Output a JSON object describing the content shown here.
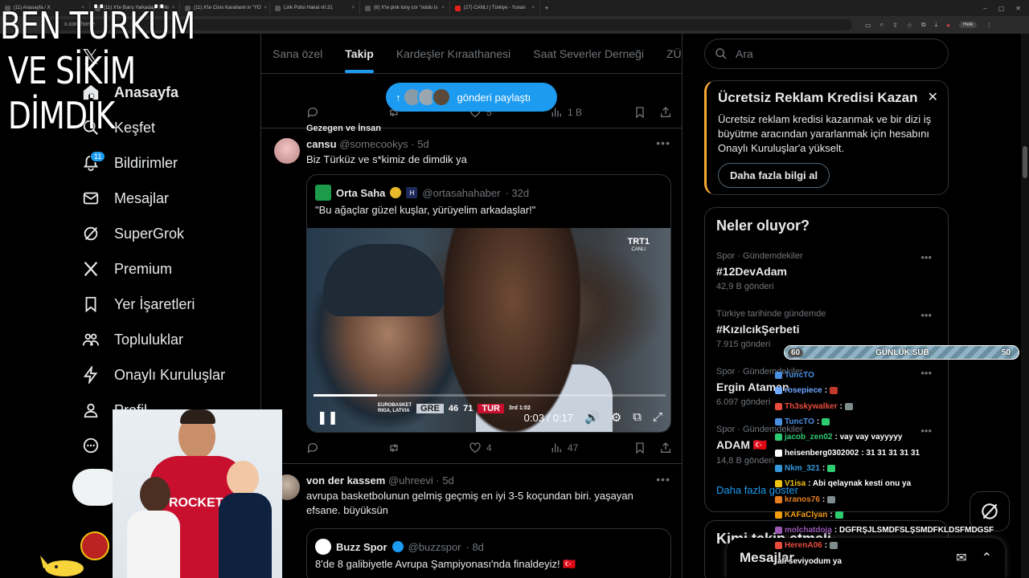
{
  "browser": {
    "tabs": [
      {
        "label": "(11) Anasayfa / X",
        "fav": "x"
      },
      {
        "label": "(11) X'te Barış Yarkadaş: Türki",
        "fav": "x"
      },
      {
        "label": "(11) X'te Cüvs Karahanlı in \"YO",
        "fav": "x"
      },
      {
        "label": "Link Polisi Hakat v0.31",
        "fav": "link"
      },
      {
        "label": "(6) X'te pink tony cor \"noldu ls",
        "fav": "x"
      },
      {
        "label": "(27) CANLI | Türkiye - Yunan",
        "fav": "yt"
      }
    ],
    "new_tab": "+",
    "url": "x.com/home",
    "profile": "Hele"
  },
  "overlay": {
    "line1": "BEN TÜRKÜM",
    "line2": "VE SİKİM DİMDİK"
  },
  "nav": {
    "items": [
      {
        "label": "Anasayfa",
        "icon": "home-icon"
      },
      {
        "label": "Keşfet",
        "icon": "search-icon"
      },
      {
        "label": "Bildirimler",
        "icon": "bell-icon",
        "badge": "11"
      },
      {
        "label": "Mesajlar",
        "icon": "mail-icon"
      },
      {
        "label": "SuperGrok",
        "icon": "grok-icon"
      },
      {
        "label": "Premium",
        "icon": "x-logo-icon"
      },
      {
        "label": "Yer İşaretleri",
        "icon": "bookmark-icon"
      },
      {
        "label": "Topluluklar",
        "icon": "people-icon"
      },
      {
        "label": "Onaylı Kuruluşlar",
        "icon": "lightning-icon"
      },
      {
        "label": "Profil",
        "icon": "person-icon"
      }
    ]
  },
  "tabs": [
    "Sana özel",
    "Takip",
    "Kardeşler Kıraathanesi",
    "Saat Severler Derneği",
    "ZÜPE"
  ],
  "active_tab": "Takip",
  "toast": {
    "label": "gönderi paylaştı"
  },
  "prev_post": {
    "ref_text": "Gezegen ve İnsan",
    "replies": "",
    "reposts": "",
    "likes": "5",
    "views": "1 B"
  },
  "post1": {
    "name": "cansu",
    "handle": "@somecookys",
    "time": "· 5d",
    "text": "Biz Türküz ve s*kimiz de dimdik ya",
    "quote": {
      "name": "Orta Saha",
      "handle": "@ortasahahaber",
      "time": "· 32d",
      "text": "\"Bu ağaçlar güzel kuşlar, yürüyelim arkadaşlar!\"",
      "video": {
        "channel": "TRT1",
        "channel_sub": "CANLI",
        "league": "EUROBASKET",
        "league_sub": "RIGA, LATVIA",
        "team1": "GRE",
        "score1": "46",
        "score2": "71",
        "team2": "TUR",
        "period": "3rd",
        "clock": "1:02",
        "time": "0:03 / 0:17",
        "progress": 0.18
      }
    },
    "replies": "",
    "reposts": "",
    "likes": "4",
    "views": "47"
  },
  "post2": {
    "name": "von der kassem",
    "handle": "@uhreevi",
    "time": "· 5d",
    "text": "avrupa basketbolunun gelmiş geçmiş en iyi 3-5 koçundan biri. yaşayan efsane. büyüksün",
    "quote": {
      "name": "Buzz Spor",
      "handle": "@buzzspor",
      "time": "· 8d",
      "text": "8'de 8 galibiyetle Avrupa Şampiyonası'nda finaldeyiz! 🇹🇷"
    }
  },
  "search": {
    "placeholder": "Ara"
  },
  "promo": {
    "title": "Ücretsiz Reklam Kredisi Kazan",
    "body": "Ücretsiz reklam kredisi kazanmak ve bir dizi iş büyütme aracından yararlanmak için hesabını Onaylı Kuruluşlar'a yükselt.",
    "cta": "Daha fazla bilgi al"
  },
  "trends": {
    "title": "Neler oluyor?",
    "items": [
      {
        "cat": "Spor · Gündemdekiler",
        "title": "#12DevAdam",
        "count": "42,9 B gönderi"
      },
      {
        "cat": "Türkiye tarihinde gündemde",
        "title": "#KızılcıkŞerbeti",
        "count": "7.915 gönderi"
      },
      {
        "cat": "Spor · Gündemdekiler",
        "title": "Ergin Ataman",
        "count": "6.097 gönderi"
      },
      {
        "cat": "Spor · Gündemdekiler",
        "title": "ADAM 🇹🇷",
        "count": "14,8 B gönderi"
      }
    ],
    "show_more": "Daha fazla göster"
  },
  "who_follow": {
    "title": "Kimi takip etmeli"
  },
  "subbar": {
    "left": "60",
    "label": "GÜNLÜK SUB",
    "right": "50",
    "progress": 0.6
  },
  "chat": [
    {
      "user": "TuncTO",
      "color": "#4a90e2",
      "msg": ""
    },
    {
      "user": "rosepiece",
      "color": "#6fa8ff",
      "msg": ":"
    },
    {
      "user": "Th3skywalker",
      "color": "#e74c3c",
      "msg": ":"
    },
    {
      "user": "TuncTO",
      "color": "#4a90e2",
      "msg": ":"
    },
    {
      "user": "jacob_zen02",
      "color": "#2ecc71",
      "msg": ": vay vay vayyyyy"
    },
    {
      "user": "heisenberg0302002",
      "color": "#ffffff",
      "msg": ": 31 31 31 31 31"
    },
    {
      "user": "Nkm_321",
      "color": "#3498db",
      "msg": ":"
    },
    {
      "user": "V1isa",
      "color": "#f1c40f",
      "msg": ": Abi qelaynak kesti onu ya"
    },
    {
      "user": "kranos76",
      "color": "#e67e22",
      "msg": ":"
    },
    {
      "user": "KAFaClyan",
      "color": "#f39c12",
      "msg": ":"
    },
    {
      "user": "molchatdoja",
      "color": "#9b59b6",
      "msg": ": DGFRŞJLSMDFSLŞSMDFKLDSFMDGSF"
    },
    {
      "user": "HerenA06",
      "color": "#e74c3c",
      "msg": ":"
    },
    {
      "user": "",
      "color": "#ffffff",
      "msg": "ali seviyodum ya"
    }
  ],
  "messages_drawer": {
    "title": "Mesajlar"
  },
  "colors": {
    "accent": "#1d9bf0",
    "background": "#000000",
    "border": "#2f3336",
    "muted": "#71767b"
  }
}
